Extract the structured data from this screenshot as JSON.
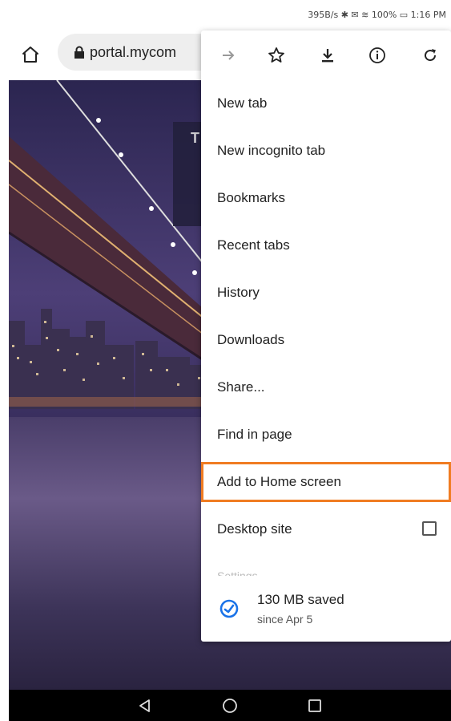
{
  "status_bar": {
    "text": "395B/s ✱ ✉ ≋ 100% ▭ 1:16 PM"
  },
  "toolbar": {
    "url": "portal.mycom"
  },
  "page": {
    "card_initial": "T"
  },
  "menu": {
    "icons": [
      "forward-icon",
      "star-icon",
      "download-icon",
      "info-icon",
      "refresh-icon"
    ],
    "items": [
      {
        "label": "New tab"
      },
      {
        "label": "New incognito tab"
      },
      {
        "label": "Bookmarks"
      },
      {
        "label": "Recent tabs"
      },
      {
        "label": "History"
      },
      {
        "label": "Downloads"
      },
      {
        "label": "Share..."
      },
      {
        "label": "Find in page"
      },
      {
        "label": "Add to Home screen"
      },
      {
        "label": "Desktop site"
      }
    ],
    "settings_label": "Settings",
    "savings_title": "130 MB saved",
    "savings_sub": "since Apr 5",
    "highlight_color": "#f07c22"
  }
}
